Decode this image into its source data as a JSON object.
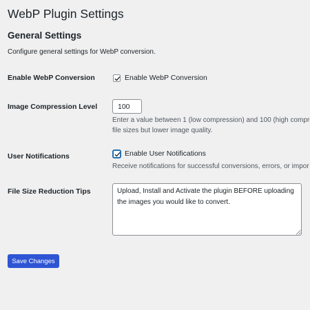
{
  "page": {
    "title": "WebP Plugin Settings"
  },
  "section": {
    "title": "General Settings",
    "description": "Configure general settings for WebP conversion."
  },
  "fields": {
    "enable_conversion": {
      "label": "Enable WebP Conversion",
      "checkbox_label": "Enable WebP Conversion",
      "checked": true
    },
    "compression_level": {
      "label": "Image Compression Level",
      "value": "100",
      "help_line1": "Enter a value between 1 (low compression) and 100 (high compre",
      "help_line2": "file sizes but lower image quality."
    },
    "user_notifications": {
      "label": "User Notifications",
      "checkbox_label": "Enable User Notifications",
      "checked": true,
      "help": "Receive notifications for successful conversions, errors, or impor"
    },
    "file_size_tips": {
      "label": "File Size Reduction Tips",
      "value": "Upload, Install and Activate the plugin BEFORE uploading the images you would like to convert."
    }
  },
  "actions": {
    "save_label": "Save Changes"
  },
  "colors": {
    "background": "#f0f0f1",
    "primary_button": "#2f55d4",
    "focus_ring": "#2271b1"
  }
}
